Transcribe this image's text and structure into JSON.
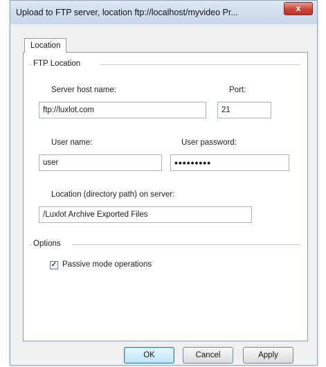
{
  "window": {
    "title": "Upload to FTP server, location ftp://localhost/myvideo Pr...",
    "close_glyph": "x"
  },
  "tabs": [
    {
      "label": "Location",
      "selected": true
    }
  ],
  "ftp_location": {
    "group_label": "FTP Location",
    "server_host": {
      "label": "Server host name:",
      "value": "ftp://luxlot.com"
    },
    "port": {
      "label": "Port:",
      "value": "21"
    },
    "user_name": {
      "label": "User name:",
      "value": "user"
    },
    "user_password": {
      "label": "User password:",
      "value": "•••••••••"
    },
    "location": {
      "label": "Location (directory path) on server:",
      "value": "/Luxlot Archive Exported Files"
    }
  },
  "options": {
    "group_label": "Options",
    "passive_mode": {
      "label": "Passive mode operations",
      "checked": true,
      "check_glyph": "✓"
    }
  },
  "buttons": {
    "ok": "OK",
    "cancel": "Cancel",
    "apply": "Apply"
  }
}
